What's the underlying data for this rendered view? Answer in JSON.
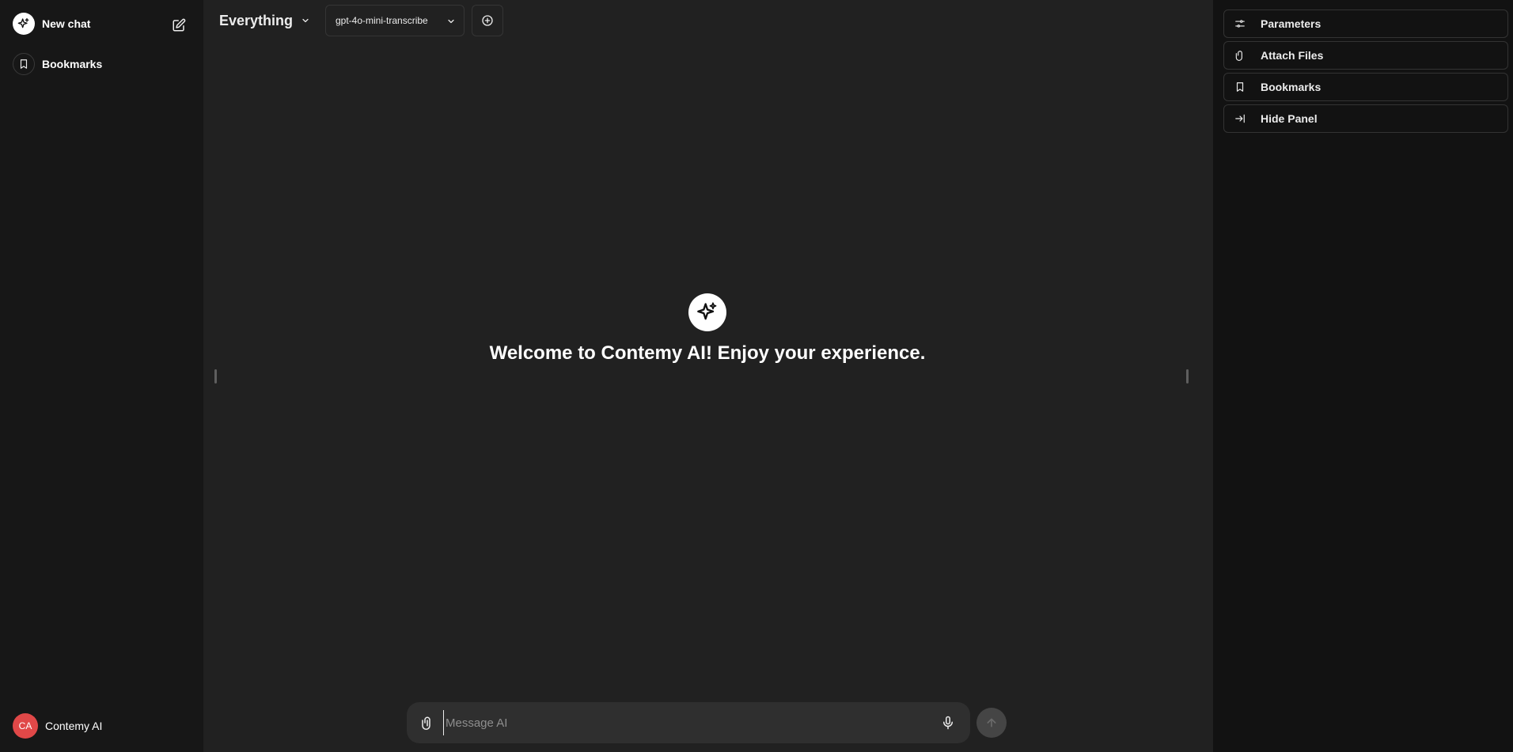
{
  "sidebar": {
    "new_chat_label": "New chat",
    "bookmarks_label": "Bookmarks",
    "user": {
      "initials": "CA",
      "name": "Contemy AI"
    }
  },
  "header": {
    "title": "Everything",
    "model": "gpt-4o-mini-transcribe"
  },
  "welcome": {
    "message": "Welcome to Contemy AI! Enjoy your experience."
  },
  "composer": {
    "placeholder": "Message AI"
  },
  "right_panel": {
    "items": [
      {
        "label": "Parameters",
        "icon": "sliders-icon"
      },
      {
        "label": "Attach Files",
        "icon": "paperclip-icon"
      },
      {
        "label": "Bookmarks",
        "icon": "bookmark-icon"
      },
      {
        "label": "Hide Panel",
        "icon": "arrow-to-right-icon"
      }
    ]
  },
  "colors": {
    "background": "#212121",
    "sidebar": "#171717",
    "right_panel": "#121212",
    "avatar": "#e04848",
    "composer": "#2f2f2f"
  }
}
